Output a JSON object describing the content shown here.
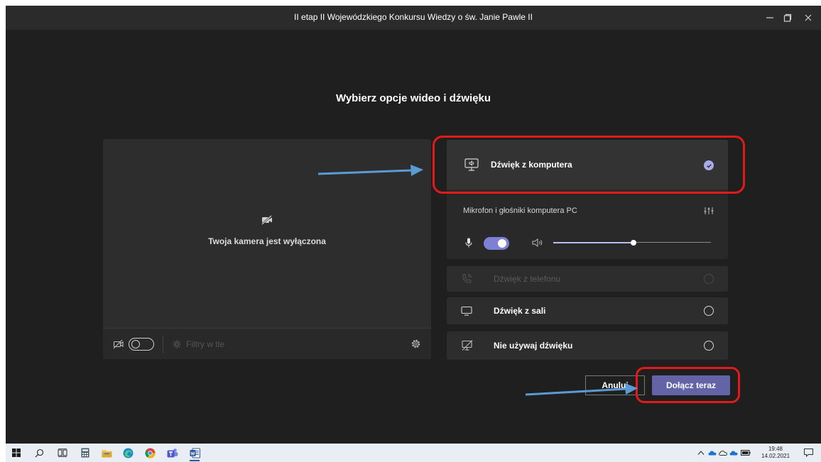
{
  "window": {
    "title": "II etap II Wojewódzkiego Konkursu Wiedzy o św. Janie Pawle II"
  },
  "dialog": {
    "heading": "Wybierz opcje wideo i dźwięku"
  },
  "preview": {
    "camera_off_label": "Twoja kamera jest wyłączona",
    "camera_on": false,
    "background_filters_label": "Filtry w tle"
  },
  "audio_options": {
    "computer": {
      "label": "Dźwięk z komputera",
      "selected": true,
      "device_label": "Mikrofon i głośniki komputera PC",
      "mic_on": true,
      "speaker_volume_percent": 51
    },
    "phone": {
      "label": "Dźwięk z telefonu",
      "disabled": true
    },
    "room": {
      "label": "Dźwięk z sali"
    },
    "none": {
      "label": "Nie używaj dźwięku"
    }
  },
  "actions": {
    "cancel_label": "Anuluj",
    "join_label": "Dołącz teraz"
  },
  "taskbar": {
    "time": "19:48",
    "date": "14.02.2021"
  },
  "colors": {
    "accent": "#6264a7",
    "highlight": "#e21a1a",
    "arrow": "#5b9bd5"
  }
}
